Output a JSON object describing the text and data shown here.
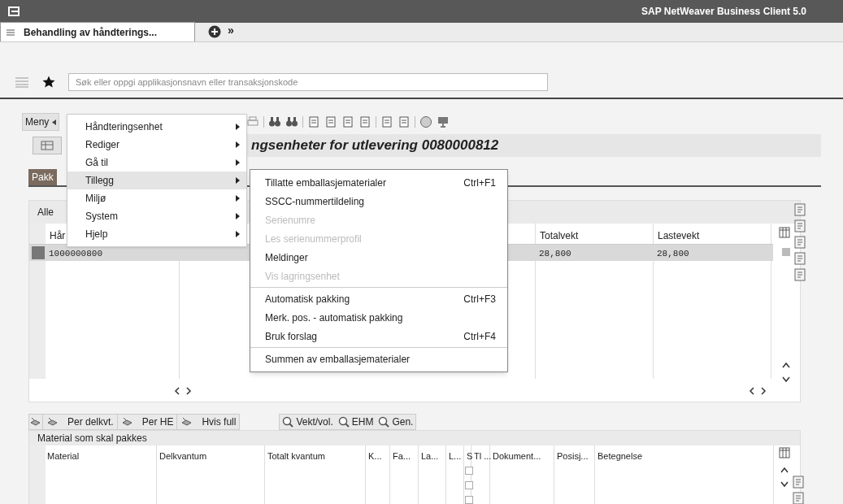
{
  "window": {
    "title": "SAP NetWeaver Business Client 5.0"
  },
  "tabs": [
    {
      "label": "Behandling av håndterings...",
      "selected": true
    }
  ],
  "tab_more": "»",
  "search": {
    "placeholder": "Søk eller oppgi applikasjonsnavn eller transaksjonskode"
  },
  "toolbar": {
    "menu_button": "Meny"
  },
  "page_title": "ngsenheter for utlevering 0080000812",
  "upper_tab": {
    "label": "Pakk",
    "selected": true
  },
  "upper_table": {
    "header": "Alle",
    "columns": [
      "Hår",
      "Totalvekt",
      "Lastevekt"
    ],
    "rows": [
      {
        "cells": [
          "1000000800",
          "28,800",
          "28,800"
        ],
        "selected": true
      }
    ]
  },
  "menu": {
    "items": [
      {
        "label": "Håndteringsenhet",
        "expanded": false
      },
      {
        "label": "Rediger",
        "expanded": false
      },
      {
        "label": "Gå til",
        "expanded": false
      },
      {
        "label": "Tillegg",
        "expanded": true
      },
      {
        "label": "Miljø",
        "expanded": false
      },
      {
        "label": "System",
        "expanded": false
      },
      {
        "label": "Hjelp",
        "expanded": false
      }
    ]
  },
  "submenu": [
    {
      "label": "Tillatte emballasjematerialer",
      "shortcut": "Ctrl+F1",
      "disabled": false,
      "separator_before": false
    },
    {
      "label": "SSCC-nummertildeling",
      "disabled": false,
      "separator_before": false
    },
    {
      "label": "Serienumre",
      "disabled": true,
      "separator_before": false
    },
    {
      "label": "Les serienummerprofil",
      "disabled": true,
      "separator_before": false
    },
    {
      "label": "Meldinger",
      "disabled": false,
      "separator_before": false
    },
    {
      "label": "Vis lagringsenhet",
      "disabled": true,
      "separator_before": false
    },
    {
      "label": "Automatisk pakking",
      "shortcut": "Ctrl+F3",
      "disabled": false,
      "separator_before": true
    },
    {
      "label": "Merk. pos. - automatisk pakking",
      "disabled": false,
      "separator_before": false
    },
    {
      "label": "Bruk forslag",
      "shortcut": "Ctrl+F4",
      "disabled": false,
      "separator_before": false
    },
    {
      "label": "Summen av emballasjematerialer",
      "disabled": false,
      "separator_before": true
    }
  ],
  "pack_buttons": [
    {
      "label": "Per delkvt."
    },
    {
      "label": "Per HE"
    },
    {
      "label": "Hvis full"
    }
  ],
  "view_buttons": [
    {
      "label": "Vekt/vol."
    },
    {
      "label": "EHM"
    },
    {
      "label": "Gen."
    }
  ],
  "lower_table": {
    "title": "Material som skal pakkes",
    "columns": [
      "Material",
      "Delkvantum",
      "Totalt kvantum",
      "K...",
      "Fa...",
      "La...",
      "L...",
      "S",
      "Tl ...",
      "Dokument...",
      "Posisj...",
      "Betegnelse"
    ],
    "rows": [
      {
        "checked": false
      },
      {
        "checked": false
      },
      {
        "checked": false
      }
    ]
  }
}
